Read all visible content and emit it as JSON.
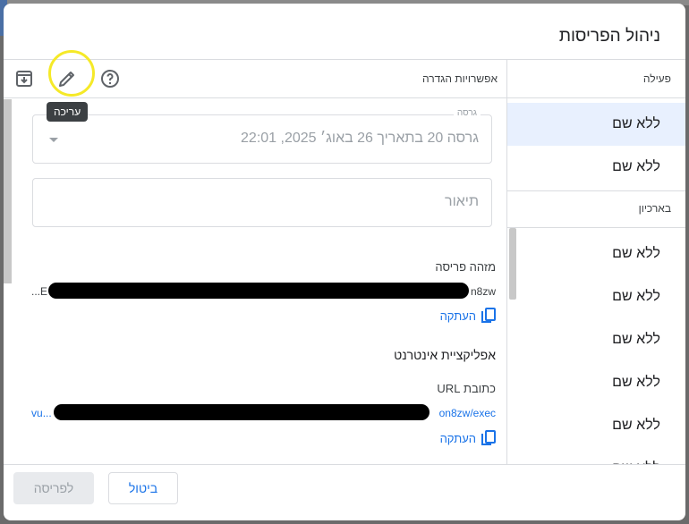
{
  "dialog": {
    "title": "ניהול הפריסות"
  },
  "sidebar": {
    "active_header": "פעילה",
    "active_items": [
      {
        "label": "ללא שם",
        "selected": true
      },
      {
        "label": "ללא שם",
        "selected": false
      }
    ],
    "archive_header": "בארכיון",
    "archive_items": [
      {
        "label": "ללא שם"
      },
      {
        "label": "ללא שם"
      },
      {
        "label": "ללא שם"
      },
      {
        "label": "ללא שם"
      },
      {
        "label": "ללא שם"
      },
      {
        "label": "ללא שם"
      }
    ]
  },
  "main": {
    "header_title": "אפשרויות הגדרה",
    "toolbar": {
      "archive_icon": "archive-icon",
      "edit_icon": "pencil-icon",
      "help_icon": "help-circle-icon",
      "edit_tooltip": "עריכה"
    },
    "version_field": {
      "label": "גרסה",
      "value": "גרסה 20 בתאריך 26 באוג׳ 2025, 22:01"
    },
    "description_field": {
      "placeholder": "תיאור"
    },
    "deployment_id": {
      "label": "מזהה פריסה",
      "value_start": "E...",
      "value_end": "n8zw",
      "copy_label": "העתקה"
    },
    "web_app": {
      "section_title": "אפליקציית אינטרנט",
      "url_label": "כתובת URL",
      "url_start": "...vu",
      "url_end": "on8zw/exec",
      "copy_label": "העתקה"
    }
  },
  "footer": {
    "cancel_label": "ביטול",
    "deploy_label": "לפריסה"
  },
  "colors": {
    "accent": "#1a73e8",
    "selected_bg": "#e8f0fe",
    "highlight": "#f5e928"
  }
}
